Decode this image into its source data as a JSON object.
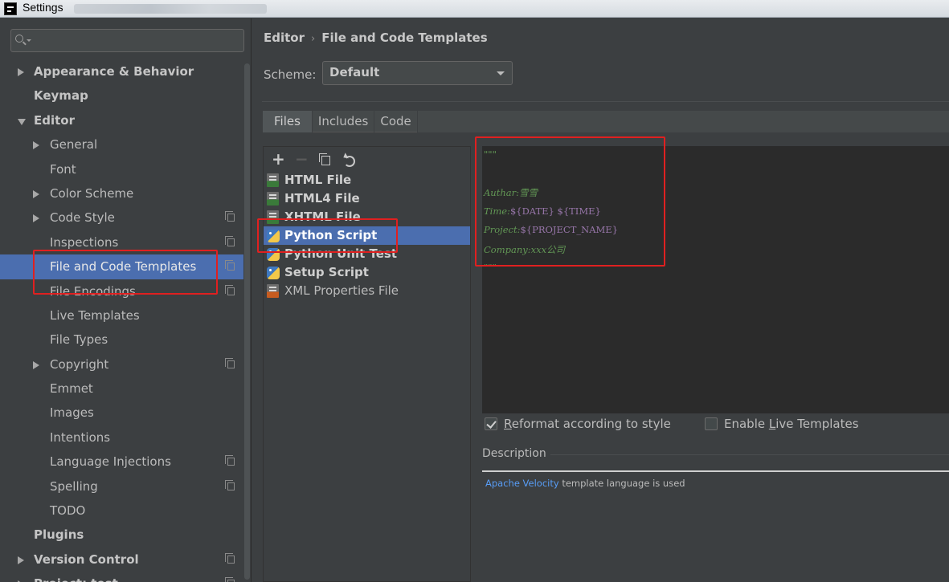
{
  "window": {
    "title": "Settings"
  },
  "sidebar": {
    "search": {
      "placeholder": "",
      "value": ""
    },
    "items": [
      {
        "label": "Appearance & Behavior",
        "level": 0,
        "arrow": "right",
        "bold": true,
        "copy_icon": false,
        "selected": false
      },
      {
        "label": "Keymap",
        "level": 0,
        "arrow": "none",
        "bold": true,
        "copy_icon": false,
        "selected": false
      },
      {
        "label": "Editor",
        "level": 0,
        "arrow": "down",
        "bold": true,
        "copy_icon": false,
        "selected": false
      },
      {
        "label": "General",
        "level": 1,
        "arrow": "right",
        "bold": false,
        "copy_icon": false,
        "selected": false
      },
      {
        "label": "Font",
        "level": 1,
        "arrow": "none",
        "bold": false,
        "copy_icon": false,
        "selected": false
      },
      {
        "label": "Color Scheme",
        "level": 1,
        "arrow": "right",
        "bold": false,
        "copy_icon": false,
        "selected": false
      },
      {
        "label": "Code Style",
        "level": 1,
        "arrow": "right",
        "bold": false,
        "copy_icon": true,
        "selected": false
      },
      {
        "label": "Inspections",
        "level": 1,
        "arrow": "none",
        "bold": false,
        "copy_icon": true,
        "selected": false
      },
      {
        "label": "File and Code Templates",
        "level": 1,
        "arrow": "none",
        "bold": false,
        "copy_icon": true,
        "selected": true
      },
      {
        "label": "File Encodings",
        "level": 1,
        "arrow": "none",
        "bold": false,
        "copy_icon": true,
        "selected": false
      },
      {
        "label": "Live Templates",
        "level": 1,
        "arrow": "none",
        "bold": false,
        "copy_icon": false,
        "selected": false
      },
      {
        "label": "File Types",
        "level": 1,
        "arrow": "none",
        "bold": false,
        "copy_icon": false,
        "selected": false
      },
      {
        "label": "Copyright",
        "level": 1,
        "arrow": "right",
        "bold": false,
        "copy_icon": true,
        "selected": false
      },
      {
        "label": "Emmet",
        "level": 1,
        "arrow": "none",
        "bold": false,
        "copy_icon": false,
        "selected": false
      },
      {
        "label": "Images",
        "level": 1,
        "arrow": "none",
        "bold": false,
        "copy_icon": false,
        "selected": false
      },
      {
        "label": "Intentions",
        "level": 1,
        "arrow": "none",
        "bold": false,
        "copy_icon": false,
        "selected": false
      },
      {
        "label": "Language Injections",
        "level": 1,
        "arrow": "none",
        "bold": false,
        "copy_icon": true,
        "selected": false
      },
      {
        "label": "Spelling",
        "level": 1,
        "arrow": "none",
        "bold": false,
        "copy_icon": true,
        "selected": false
      },
      {
        "label": "TODO",
        "level": 1,
        "arrow": "none",
        "bold": false,
        "copy_icon": false,
        "selected": false
      },
      {
        "label": "Plugins",
        "level": 0,
        "arrow": "none",
        "bold": true,
        "copy_icon": false,
        "selected": false
      },
      {
        "label": "Version Control",
        "level": 0,
        "arrow": "right",
        "bold": true,
        "copy_icon": true,
        "selected": false
      },
      {
        "label": "Project: test",
        "level": 0,
        "arrow": "right",
        "bold": true,
        "copy_icon": true,
        "selected": false
      }
    ]
  },
  "header": {
    "breadcrumb": [
      "Editor",
      "File and Code Templates"
    ],
    "separator": "›"
  },
  "scheme": {
    "label": "Scheme:",
    "value": "Default"
  },
  "tabs": [
    {
      "label": "Files",
      "active": true
    },
    {
      "label": "Includes",
      "active": false
    },
    {
      "label": "Code",
      "active": false
    }
  ],
  "toolbar": {
    "add": "+",
    "remove": "−",
    "copy_icon": "copy-icon",
    "reset_icon": "reset-icon"
  },
  "templates": [
    {
      "label": "HTML File",
      "icon": "html",
      "bold": true,
      "selected": false
    },
    {
      "label": "HTML4 File",
      "icon": "html",
      "bold": true,
      "selected": false
    },
    {
      "label": "XHTML File",
      "icon": "html",
      "bold": true,
      "selected": false
    },
    {
      "label": "Python Script",
      "icon": "python",
      "bold": true,
      "selected": true
    },
    {
      "label": "Python Unit Test",
      "icon": "python",
      "bold": true,
      "selected": false
    },
    {
      "label": "Setup Script",
      "icon": "python",
      "bold": true,
      "selected": false
    },
    {
      "label": "XML Properties File",
      "icon": "xml",
      "bold": false,
      "selected": false
    }
  ],
  "editor": {
    "lines": [
      {
        "parts": [
          {
            "t": "\"\"\"",
            "v": false
          }
        ]
      },
      {
        "parts": [
          {
            "t": "",
            "v": false
          }
        ]
      },
      {
        "parts": [
          {
            "t": "Authar:雪雪",
            "v": false
          }
        ]
      },
      {
        "parts": [
          {
            "t": "Time:",
            "v": false
          },
          {
            "t": "${DATE} ${TIME}",
            "v": true
          }
        ]
      },
      {
        "parts": [
          {
            "t": "Project:",
            "v": false
          },
          {
            "t": "${PROJECT_NAME}",
            "v": true
          }
        ]
      },
      {
        "parts": [
          {
            "t": "Company:xxx公司",
            "v": false
          }
        ]
      },
      {
        "parts": [
          {
            "t": "\"\"\"",
            "v": false
          }
        ]
      }
    ]
  },
  "options": {
    "reformat": {
      "label_pre": "",
      "label_ul": "R",
      "label_post": "eformat according to style",
      "checked": true
    },
    "live": {
      "label_pre": "Enable ",
      "label_ul": "L",
      "label_post": "ive Templates",
      "checked": false
    }
  },
  "description": {
    "label": "Description",
    "link": "Apache Velocity",
    "text": " template language is used"
  },
  "colors": {
    "selection": "#4b6eaf",
    "highlight": "#e02020",
    "comment": "#629755",
    "template_var": "#9876aa"
  }
}
